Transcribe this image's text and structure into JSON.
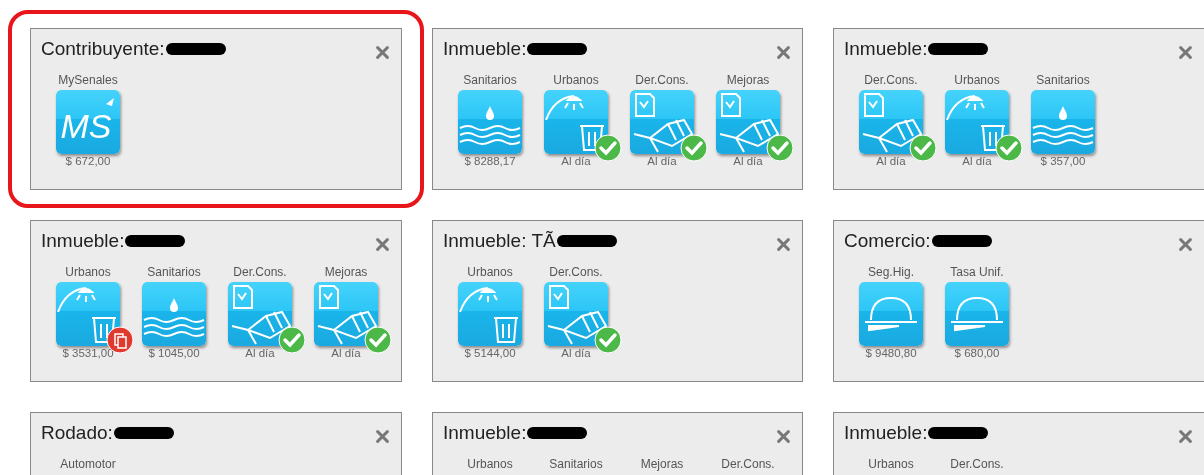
{
  "cards": [
    {
      "title": "Contribuyente:",
      "highlighted": true,
      "items": [
        {
          "label": "MySenales",
          "kind": "logo",
          "logo_text": "MS",
          "caption": "$ 672,00",
          "paid": false,
          "overdue": false
        }
      ]
    },
    {
      "title": "Inmueble:",
      "highlighted": false,
      "items": [
        {
          "label": "Sanitarios",
          "kind": "water",
          "caption": "$ 8288,17",
          "paid": false,
          "overdue": false
        },
        {
          "label": "Urbanos",
          "kind": "lamp",
          "caption": "Al día",
          "paid": true,
          "overdue": false
        },
        {
          "label": "Der.Cons.",
          "kind": "building",
          "caption": "Al día",
          "paid": true,
          "overdue": false
        },
        {
          "label": "Mejoras",
          "kind": "building",
          "caption": "Al día",
          "paid": true,
          "overdue": false
        }
      ]
    },
    {
      "title": "Inmueble:",
      "highlighted": false,
      "items": [
        {
          "label": "Der.Cons.",
          "kind": "building",
          "caption": "Al día",
          "paid": true,
          "overdue": false
        },
        {
          "label": "Urbanos",
          "kind": "lamp",
          "caption": "Al día",
          "paid": true,
          "overdue": false
        },
        {
          "label": "Sanitarios",
          "kind": "water",
          "caption": "$ 357,00",
          "paid": false,
          "overdue": false
        }
      ]
    },
    {
      "title": "Inmueble:",
      "highlighted": false,
      "items": [
        {
          "label": "Urbanos",
          "kind": "lamp",
          "caption": "$ 3531,00",
          "paid": false,
          "overdue": true
        },
        {
          "label": "Sanitarios",
          "kind": "water",
          "caption": "$ 1045,00",
          "paid": false,
          "overdue": false
        },
        {
          "label": "Der.Cons.",
          "kind": "building",
          "caption": "Al día",
          "paid": true,
          "overdue": false
        },
        {
          "label": "Mejoras",
          "kind": "building",
          "caption": "Al día",
          "paid": true,
          "overdue": false
        }
      ]
    },
    {
      "title": "Inmueble: TÃ",
      "highlighted": false,
      "items": [
        {
          "label": "Urbanos",
          "kind": "lamp",
          "caption": "$ 5144,00",
          "paid": false,
          "overdue": false
        },
        {
          "label": "Der.Cons.",
          "kind": "building",
          "caption": "Al día",
          "paid": true,
          "overdue": false
        }
      ]
    },
    {
      "title": "Comercio:",
      "highlighted": false,
      "items": [
        {
          "label": "Seg.Hig.",
          "kind": "helmet",
          "caption": "$ 9480,80",
          "paid": false,
          "overdue": false
        },
        {
          "label": "Tasa Unif.",
          "kind": "helmet",
          "caption": "$ 680,00",
          "paid": false,
          "overdue": false
        }
      ]
    },
    {
      "title": "Rodado:",
      "highlighted": false,
      "items": [
        {
          "label": "Automotor"
        }
      ]
    },
    {
      "title": "Inmueble:",
      "highlighted": false,
      "items": [
        {
          "label": "Urbanos"
        },
        {
          "label": "Sanitarios"
        },
        {
          "label": "Mejoras"
        },
        {
          "label": "Der.Cons."
        }
      ]
    },
    {
      "title": "Inmueble:",
      "highlighted": false,
      "items": [
        {
          "label": "Urbanos"
        },
        {
          "label": "Der.Cons."
        }
      ]
    }
  ]
}
